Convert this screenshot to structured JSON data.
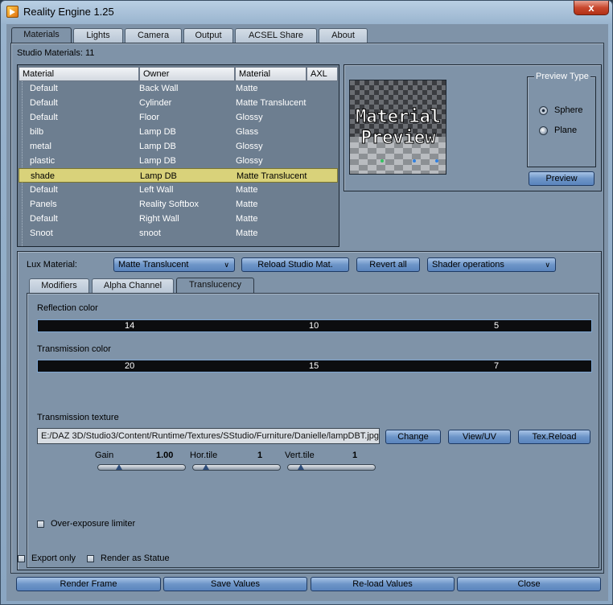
{
  "window": {
    "title": "Reality Engine 1.25",
    "close_glyph": "x"
  },
  "main_tabs": [
    "Materials",
    "Lights",
    "Camera",
    "Output",
    "ACSEL Share",
    "About"
  ],
  "studio_materials": "Studio Materials: 11",
  "table": {
    "headers": [
      "Material",
      "Owner",
      "Material",
      "AXL"
    ],
    "rows": [
      [
        "Default",
        "Back Wall",
        "Matte"
      ],
      [
        "Default",
        "Cylinder",
        "Matte Translucent"
      ],
      [
        "Default",
        "Floor",
        "Glossy"
      ],
      [
        "bilb",
        "Lamp DB",
        "Glass"
      ],
      [
        "metal",
        "Lamp DB",
        "Glossy"
      ],
      [
        "plastic",
        "Lamp DB",
        "Glossy"
      ],
      [
        "shade",
        "Lamp DB",
        "Matte Translucent"
      ],
      [
        "Default",
        "Left Wall",
        "Matte"
      ],
      [
        "Panels",
        "Reality Softbox",
        "Matte"
      ],
      [
        "Default",
        "Right Wall",
        "Matte"
      ],
      [
        "Snoot",
        "snoot",
        "Matte"
      ]
    ],
    "selected_index": 6
  },
  "preview": {
    "image_text_1": "Material",
    "image_text_2": "Preview",
    "type_title": "Preview Type",
    "options": [
      "Sphere",
      "Plane"
    ],
    "selected": "Sphere",
    "button": "Preview"
  },
  "lux": {
    "label": "Lux Material:",
    "value": "Matte Translucent",
    "reload": "Reload Studio Mat.",
    "revert": "Revert all",
    "shader_ops": "Shader operations"
  },
  "sub_tabs": [
    "Modifiers",
    "Alpha Channel",
    "Translucency"
  ],
  "translucency": {
    "reflection_label": "Reflection color",
    "reflection": [
      "14",
      "10",
      "5"
    ],
    "transmission_label": "Transmission color",
    "transmission": [
      "20",
      "15",
      "7"
    ],
    "texture_label": "Transmission texture",
    "texture_path": "E:/DAZ 3D/Studio3/Content/Runtime/Textures/SStudio/Furniture/Danielle/lampDBT.jpg",
    "buttons": [
      "Change",
      "View/UV",
      "Tex.Reload"
    ],
    "gain_label": "Gain",
    "gain_value": "1.00",
    "hor_label": "Hor.tile",
    "hor_value": "1",
    "vert_label": "Vert.tile",
    "vert_value": "1",
    "overexposure": "Over-exposure limiter"
  },
  "bottom": {
    "export_only": "Export only",
    "render_statue": "Render as Statue",
    "buttons": [
      "Render Frame",
      "Save Values",
      "Re-load Values",
      "Close"
    ]
  }
}
